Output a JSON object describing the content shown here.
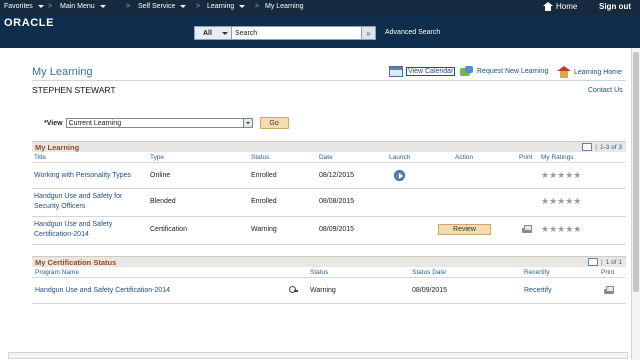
{
  "nav": {
    "favorites": "Favorites",
    "main_menu": "Main Menu",
    "self_service": "Self Service",
    "learning": "Learning",
    "my_learning": "My Learning",
    "home": "Home",
    "sign_out": "Sign out",
    "separator": ">"
  },
  "header": {
    "logo": "ORACLE",
    "search_scope": "All",
    "search_value": "Search",
    "search_go": "»",
    "advanced_search": "Advanced Search"
  },
  "page": {
    "title": "My Learning",
    "user_name": "STEPHEN STEWART",
    "contact_us": "Contact Us",
    "links": {
      "view_calendar": "View Calendar",
      "request_new_learning": "Request New Learning",
      "learning_home": "Learning Home"
    }
  },
  "view": {
    "label": "*View",
    "selected": "Current Learning",
    "go": "Go"
  },
  "my_learning": {
    "title": "My Learning",
    "pagination": "1-3 of 3",
    "columns": [
      "Title",
      "Type",
      "Status",
      "Date",
      "Launch",
      "Action",
      "Print",
      "My Ratings"
    ],
    "rows": [
      {
        "title_line1": "Working with Personality Types",
        "title_line2": "",
        "type": "Online",
        "status": "Enrolled",
        "date": "08/12/2015",
        "launch": true,
        "action": "",
        "print": false,
        "rating": "★★★★★"
      },
      {
        "title_line1": "Handgun Use and Safety for",
        "title_line2": "Security Officers",
        "type": "Blended",
        "status": "Enrolled",
        "date": "08/08/2015",
        "launch": false,
        "action": "",
        "print": false,
        "rating": "★★★★★"
      },
      {
        "title_line1": "Handgun Use and Safety",
        "title_line2": "Certification-2014",
        "type": "Certification",
        "status": "Warning",
        "date": "08/09/2015",
        "launch": false,
        "action": "Review",
        "print": true,
        "rating": "★★★★★"
      }
    ]
  },
  "cert_status": {
    "title": "My Certification Status",
    "pagination": "1 of 1",
    "columns": [
      "Program Name",
      "Status",
      "Status Date",
      "Recertify",
      "Print"
    ],
    "rows": [
      {
        "program": "Handgun Use and Safety Certification-2014",
        "status": "Warning",
        "status_date": "08/09/2015",
        "recertify": "Recertify"
      }
    ]
  },
  "icons": {
    "home": "home-icon",
    "calendar": "calendar-icon",
    "request": "request-learning-icon",
    "learning_home": "learning-home-icon",
    "launch": "launch-icon",
    "print": "printer-icon",
    "grid_view": "grid-view-icon",
    "key": "key-icon"
  },
  "colors": {
    "nav_bg": "#17293d",
    "header_bg": "#0f2d4c",
    "section_title": "#9a4a18",
    "link": "#1f4d86",
    "button_bg": "#f5dcb0"
  }
}
